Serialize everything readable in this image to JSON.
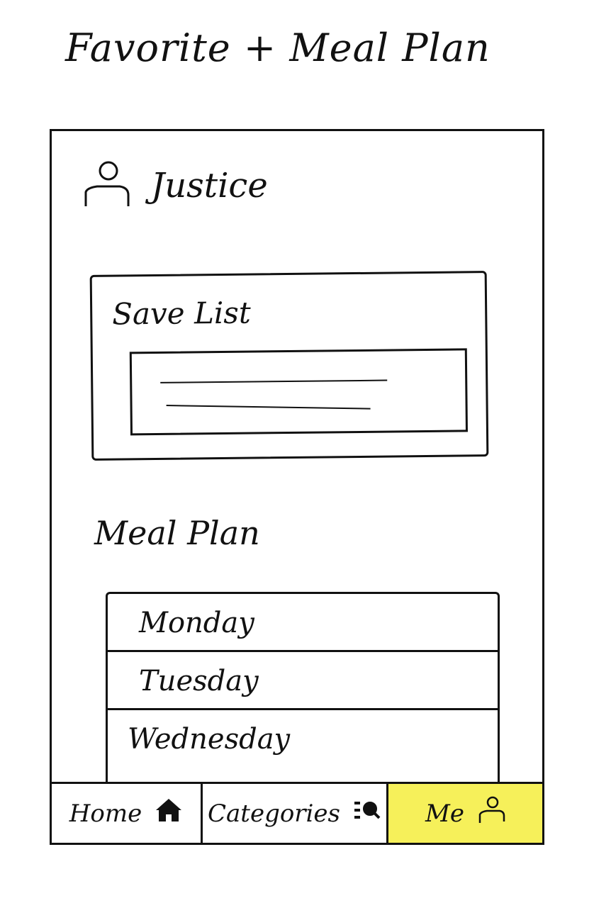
{
  "page": {
    "title": "Favorite + Meal Plan"
  },
  "profile": {
    "name": "Justice",
    "icon": "user-icon"
  },
  "save_list": {
    "title": "Save List"
  },
  "meal_plan": {
    "title": "Meal Plan",
    "days": [
      "Monday",
      "Tuesday",
      "Wednesday"
    ]
  },
  "nav": {
    "home": {
      "label": "Home",
      "icon": "home-icon"
    },
    "categories": {
      "label": "Categories",
      "icon": "search-list-icon"
    },
    "me": {
      "label": "Me",
      "icon": "user-icon",
      "active_color": "#f6f05a"
    }
  }
}
